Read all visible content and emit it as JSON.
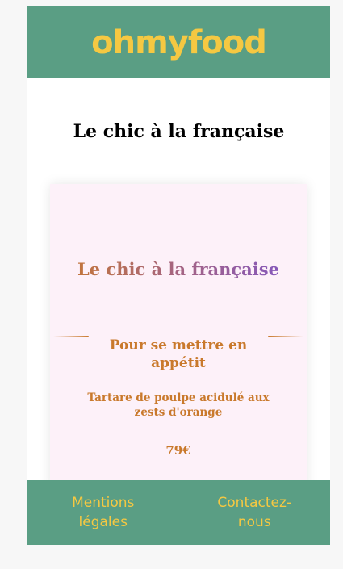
{
  "header": {
    "logo": "ohmyfood"
  },
  "main": {
    "heading": "Le chic à la française"
  },
  "card": {
    "title": "Le chic à la française",
    "section_title": "Pour se mettre en appétit",
    "dish_name": "Tartare de poulpe acidulé aux zests d'orange",
    "price": "79€"
  },
  "footer": {
    "links": [
      {
        "label": "Mentions légales"
      },
      {
        "label": "Contactez-nous"
      }
    ]
  },
  "colors": {
    "brand_green": "#5a9e84",
    "brand_yellow": "#f5c842",
    "accent_orange": "#c9792c",
    "accent_purple": "#7e55c8",
    "card_background": "#fdf1f9"
  }
}
